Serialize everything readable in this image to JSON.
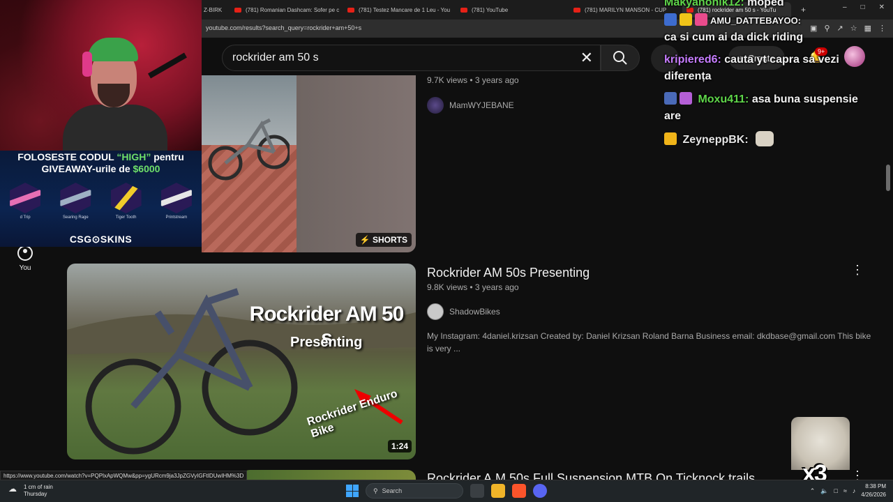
{
  "browser": {
    "tabs": [
      {
        "label": "Z-BIRK"
      },
      {
        "label": "(781) Romanian Dashcam: Sofer pe c"
      },
      {
        "label": "(781) Testez Mancare de 1 Leu - You"
      },
      {
        "label": "(781) YouTube"
      },
      {
        "label": "(781) MARILYN MANSON - CUP"
      },
      {
        "label": "(781) rockrider am 50 s - YouTu"
      }
    ],
    "url": "youtube.com/results?search_query=rockrider+am+50+s",
    "status_url": "https://www.youtube.com/watch?v=PQPlxApWQMw&pp=ygURcm9ja3JpZGVyIGFtIDUwIHM%3D"
  },
  "masthead": {
    "search_value": "rockrider am 50 s",
    "create_label": "Create",
    "notifications_badge": "9+"
  },
  "guide": {
    "you_label": "You"
  },
  "results": [
    {
      "badge": "SHORTS",
      "meta": "9.7K views • 3 years ago",
      "channel": "MamWYJEBANE"
    },
    {
      "title": "Rockrider AM 50s Presenting",
      "meta": "9.8K views • 3 years ago",
      "channel": "ShadowBikes",
      "description": "My Instagram: 4daniel.krizsan Created by: Daniel Krizsan Roland Barna Business email: dkdbase@gmail.com This bike is very ...",
      "duration": "1:24",
      "thumb_title": "Rockrider AM 50 s",
      "thumb_subtitle": "Presenting",
      "thumb_caption": "Rockrider Enduro Bike"
    },
    {
      "title": "Rockrider A.M 50s Full Suspension MTB On Ticknock trails"
    }
  ],
  "overlay": {
    "promo_line1_pre": "FOLOSESTE CODUL ",
    "promo_code": "“HIGH”",
    "promo_line1_post": " pentru",
    "promo_line2_pre": "GIVEAWAY-urile de ",
    "promo_amount": "$6000",
    "skins": [
      "d Trip",
      "Searing Rage",
      "Tiger Tooth",
      "Printstream"
    ],
    "promo_brand": "CSG⊙SKINS",
    "chat": [
      {
        "user": "Makyanonik12:",
        "message": "moped",
        "color": "#5fd64a"
      },
      {
        "user": "",
        "message": "ca si cum ai da dick riding",
        "color": "#ffffff"
      },
      {
        "user": "kripiered6:",
        "message": "cauta yt capra sa vezi diferența",
        "color": "#c77dff"
      },
      {
        "user": "Moxu411:",
        "message": "asa buna suspensie are",
        "color": "#5fd64a"
      },
      {
        "user": "ZeyneppBK:",
        "message": "",
        "color": "#e6e6e6"
      }
    ],
    "emote_banner": "AMU_DATTEBAYOO:",
    "multiplier": "x3"
  },
  "taskbar": {
    "weather_line1": "1 cm of rain",
    "weather_line2": "Thursday",
    "search_label": "Search",
    "time": "8:38 PM",
    "date": "4/26/2026"
  },
  "colors": {
    "youtube_red": "#e62117",
    "accent_green": "#6ee06a"
  }
}
